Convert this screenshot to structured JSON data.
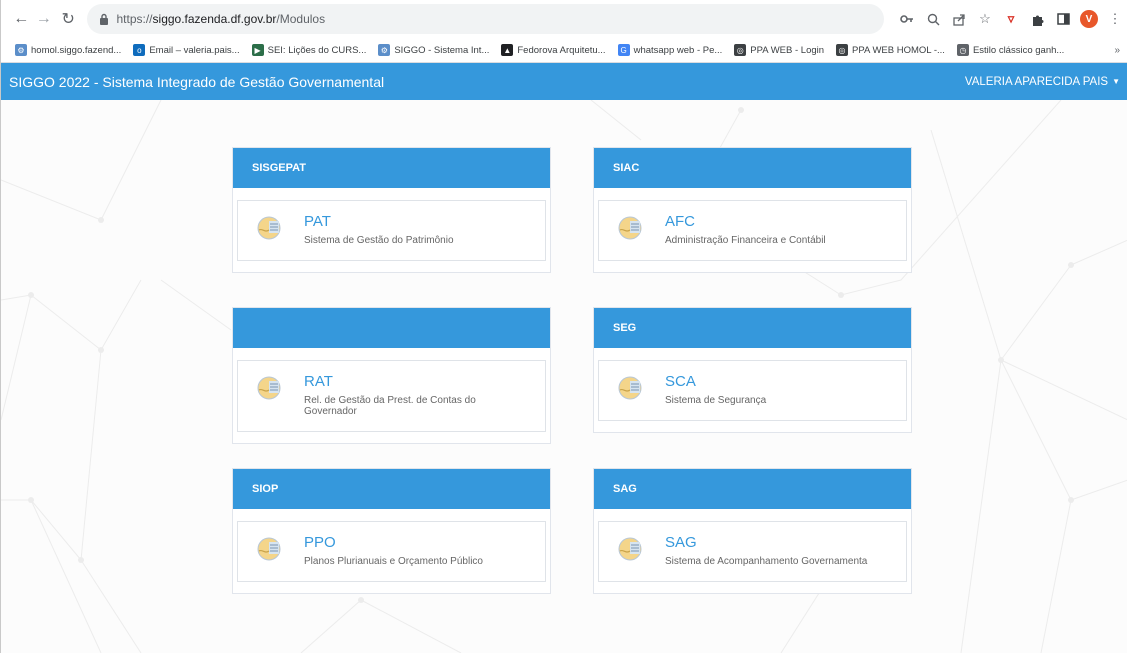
{
  "browser": {
    "url_prefix": "https://",
    "url_host": "siggo.fazenda.df.gov.br",
    "url_path": "/Modulos",
    "profile_initial": "V",
    "bookmarks": [
      {
        "label": "homol.siggo.fazend...",
        "icon": "siggo-icon",
        "color": "#5b8ec9"
      },
      {
        "label": "Email – valeria.pais...",
        "icon": "outlook-icon",
        "color": "#0f6cbd"
      },
      {
        "label": "SEI: Lições do CURS...",
        "icon": "sei-icon",
        "color": "#2c6e49"
      },
      {
        "label": "SIGGO - Sistema Int...",
        "icon": "siggo-icon",
        "color": "#5b8ec9"
      },
      {
        "label": "Fedorova Arquitetu...",
        "icon": "fedorova-icon",
        "color": "#202124"
      },
      {
        "label": "whatsapp web - Pe...",
        "icon": "google-icon",
        "color": "#4285f4"
      },
      {
        "label": "PPA WEB - Login",
        "icon": "globe-icon",
        "color": "#3c4043"
      },
      {
        "label": "PPA WEB HOMOL -...",
        "icon": "globe-icon",
        "color": "#3c4043"
      },
      {
        "label": "Estilo clássico ganh...",
        "icon": "clock-icon",
        "color": "#5f6368"
      }
    ],
    "bookmarks_more": "»"
  },
  "header": {
    "title": "SIGGO 2022 - Sistema Integrado de Gestão Governamental",
    "user": "VALERIA APARECIDA PAIS",
    "accent": "#3598dc"
  },
  "panels": [
    {
      "heading": "SISGEPAT",
      "module": {
        "name": "PAT",
        "desc": "Sistema de Gestão do Patrimônio"
      }
    },
    {
      "heading": "SIAC",
      "module": {
        "name": "AFC",
        "desc": "Administração Financeira e Contábil"
      }
    },
    {
      "heading": "",
      "module": {
        "name": "RAT",
        "desc": "Rel. de Gestão da Prest. de Contas do Governador"
      }
    },
    {
      "heading": "SEG",
      "module": {
        "name": "SCA",
        "desc": "Sistema de Segurança"
      }
    },
    {
      "heading": "SIOP",
      "module": {
        "name": "PPO",
        "desc": "Planos Plurianuais e Orçamento Público"
      }
    },
    {
      "heading": "SAG",
      "module": {
        "name": "SAG",
        "desc": "Sistema de Acompanhamento Governamenta"
      }
    }
  ]
}
